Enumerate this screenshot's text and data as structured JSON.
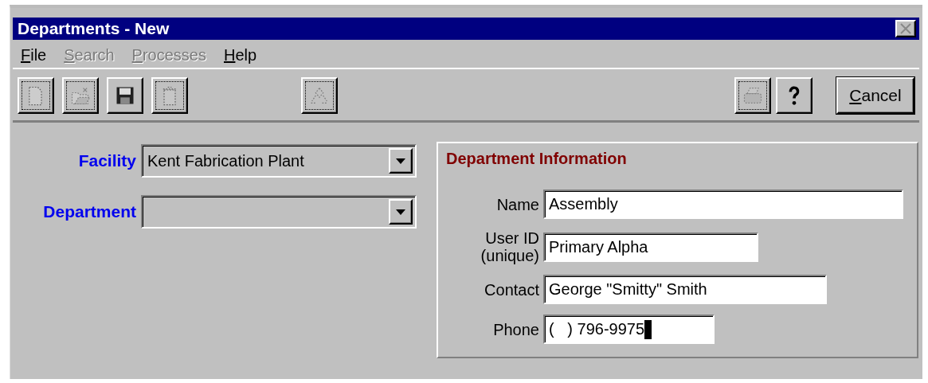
{
  "window": {
    "title": "Departments - New"
  },
  "menu": [
    {
      "label": "File",
      "disabled": false
    },
    {
      "label": "Search",
      "disabled": true
    },
    {
      "label": "Processes",
      "disabled": true
    },
    {
      "label": "Help",
      "disabled": false
    }
  ],
  "toolbar": [
    {
      "kind": "new",
      "disabled": true
    },
    {
      "kind": "open",
      "disabled": true
    },
    {
      "kind": "save",
      "disabled": false
    },
    {
      "kind": "delete",
      "disabled": true
    },
    {
      "kind": "tree",
      "disabled": true
    },
    {
      "kind": "print",
      "disabled": true
    },
    {
      "kind": "help",
      "disabled": false
    }
  ],
  "cancel_button": {
    "label": "Cancel"
  },
  "selectors": [
    {
      "label": "Facility",
      "value": "Kent Fabrication Plant"
    },
    {
      "label": "Department"
    }
  ],
  "department_information": {
    "title": "Department Information",
    "fields": [
      {
        "label": [
          "Name"
        ],
        "value": "Assembly",
        "focused": false
      },
      {
        "label": [
          "User ID",
          "(unique)"
        ],
        "value": "Primary Alpha",
        "focused": false
      },
      {
        "label": [
          "Contact"
        ],
        "value": "George \"Smitty\" Smith",
        "focused": false
      },
      {
        "label": [
          "Phone"
        ],
        "value": "(   ) 796-9975",
        "focused": true
      }
    ]
  }
}
